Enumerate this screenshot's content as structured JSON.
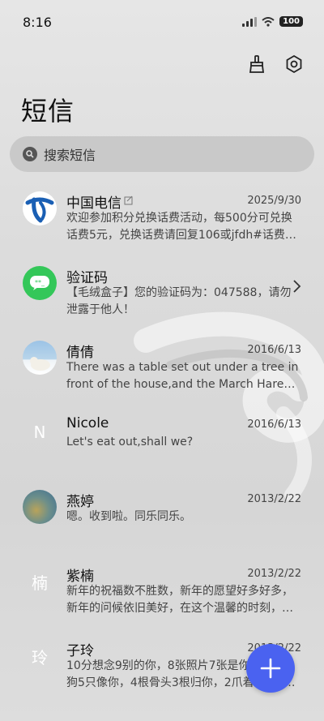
{
  "status": {
    "time": "8:16",
    "battery": "100"
  },
  "header": {
    "title": "短信",
    "icons": [
      "broom-icon",
      "settings-icon"
    ]
  },
  "search": {
    "placeholder": "搜索短信"
  },
  "messages": [
    {
      "name": "中国电信",
      "date": "2025/9/30",
      "preview": "欢迎参加积分兑换话费活动，每500分可兑换话费5元，兑换话费请回复106或jfdh#话费…",
      "avatar": "china-telecom-logo"
    },
    {
      "name": "验证码",
      "date": "",
      "preview": "【毛绒盒子】您的验证码为：047588，请勿泄露于他人！",
      "avatar": "verification-code-icon"
    },
    {
      "name": "倩倩",
      "date": "2016/6/13",
      "preview": "There was a table set out under a tree in front of the house,and the March Hare an…",
      "avatar": "photo-avatar"
    },
    {
      "name": "Nicole",
      "date": "2016/6/13",
      "preview": "Let's eat out,shall we?",
      "avatar_text": "N"
    },
    {
      "name": "燕婷",
      "date": "2013/2/22",
      "preview": "嗯。收到啦。同乐同乐。",
      "avatar": "photo-avatar"
    },
    {
      "name": "紫楠",
      "date": "2013/2/22",
      "preview": "新年的祝福数不胜数，新年的愿望好多好多，新年的问候依旧美好，在这个温馨的时刻，…",
      "avatar_text": "楠"
    },
    {
      "name": "子玲",
      "date": "2013/2/22",
      "preview": "10分想念9别的你，8张照片7张是你，6只小狗5只像你，4根骨头3根归你，2爪着地1定…",
      "avatar_text": "玲"
    }
  ],
  "colors": {
    "accent": "#4a62f0",
    "telecom_blue": "#1a5fb4",
    "message_green": "#34c759"
  }
}
